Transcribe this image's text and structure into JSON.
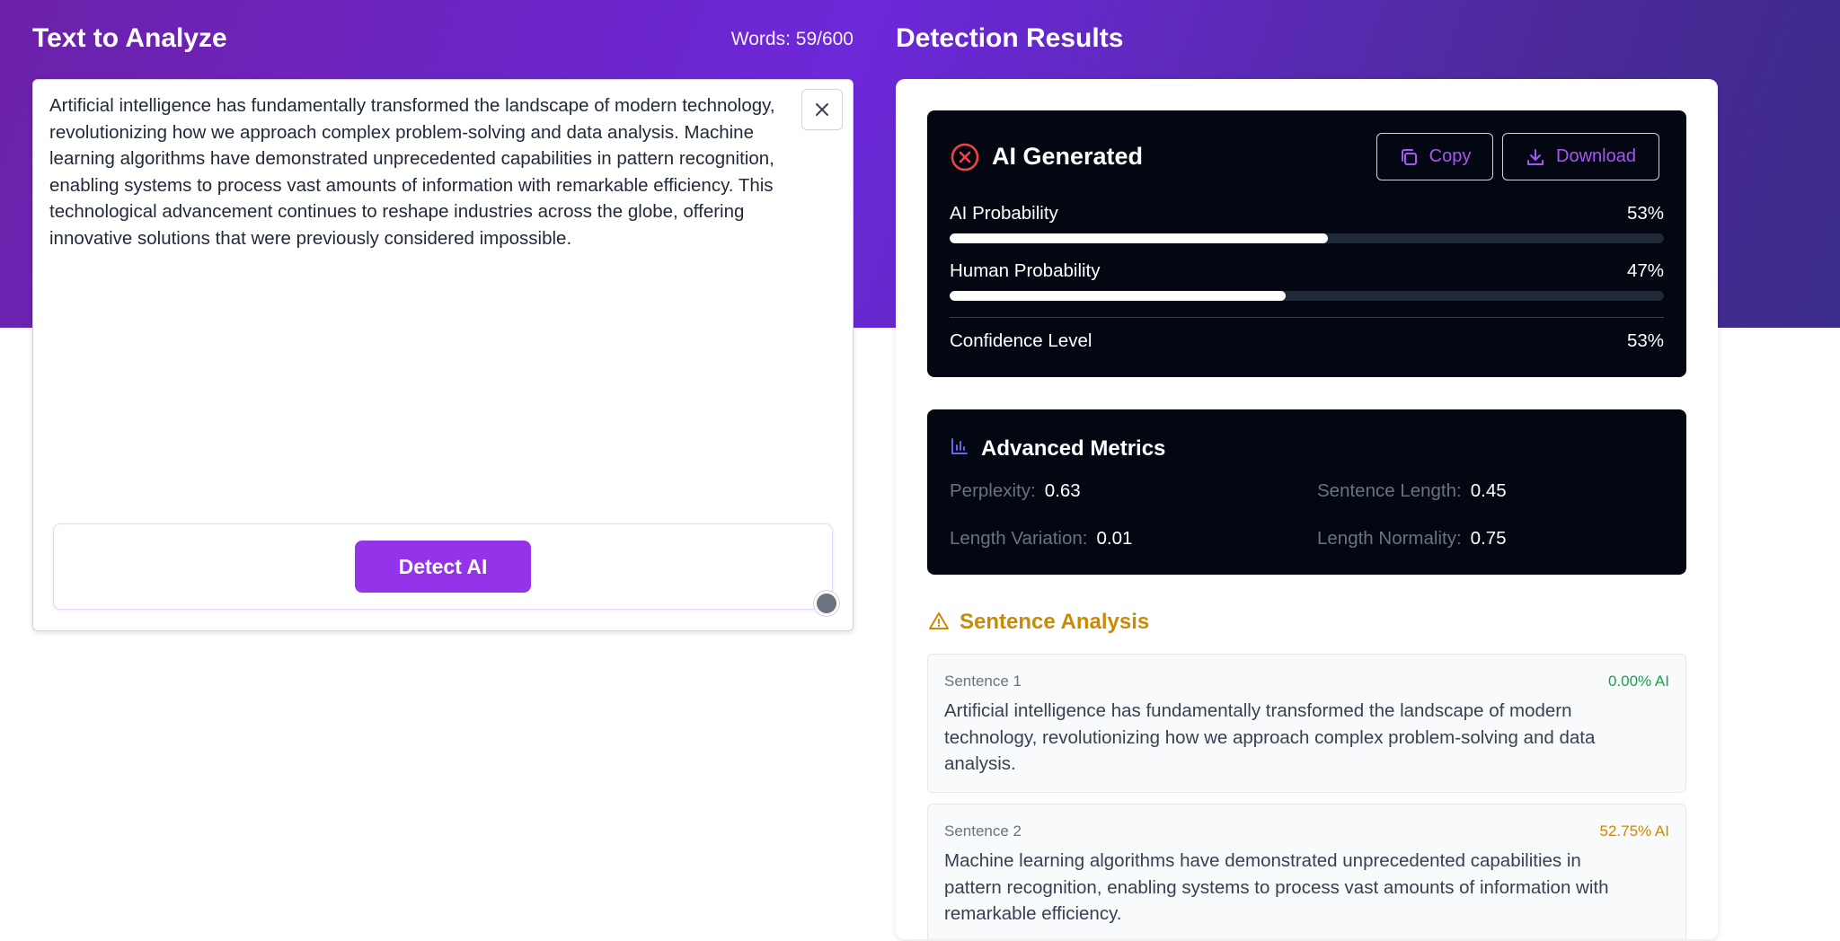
{
  "input_panel": {
    "title": "Text to Analyze",
    "word_count": "Words: 59/600",
    "text_lines": [
      "Artificial intelligence has fundamentally transformed the landscape of modern technology,",
      "revolutionizing how we approach complex problem-solving and data analysis. Machine",
      "learning algorithms have demonstrated unprecedented capabilities in pattern recognition,",
      "enabling systems to process vast amounts of information with remarkable efficiency. This",
      "technological advancement continues to reshape industries across the globe, offering",
      "innovative solutions that were previously considered impossible."
    ],
    "clear_icon": "close-icon",
    "detect_button": "Detect AI"
  },
  "results_panel": {
    "title": "Detection Results",
    "verdict": {
      "label": "AI Generated",
      "icon": "x-circle-icon",
      "icon_color": "#ef4444",
      "copy_label": "Copy",
      "download_label": "Download",
      "ai_probability_label": "AI Probability",
      "ai_probability_value": "53%",
      "ai_probability_fraction": 0.53,
      "human_probability_label": "Human Probability",
      "human_probability_value": "47%",
      "human_probability_fraction": 0.47,
      "confidence_label": "Confidence Level",
      "confidence_value": "53%"
    },
    "advanced": {
      "title": "Advanced Metrics",
      "icon": "bar-chart-icon",
      "perplexity_label": "Perplexity:",
      "perplexity_value": "0.63",
      "sentence_length_label": "Sentence Length:",
      "sentence_length_value": "0.45",
      "length_variation_label": "Length Variation:",
      "length_variation_value": "0.01",
      "length_normality_label": "Length Normality:",
      "length_normality_value": "0.75"
    },
    "sentence_analysis": {
      "title": "Sentence Analysis",
      "icon": "warning-triangle-icon",
      "sentences": [
        {
          "label": "Sentence 1",
          "pct": "0.00% AI",
          "pct_color": "#16a34a",
          "lines": [
            "Artificial intelligence has fundamentally transformed the landscape of modern",
            "technology, revolutionizing how we approach complex problem-solving and data",
            "analysis."
          ]
        },
        {
          "label": "Sentence 2",
          "pct": "52.75% AI",
          "pct_color": "#ca8a04",
          "lines": [
            "Machine learning algorithms have demonstrated unprecedented capabilities in",
            "pattern recognition, enabling systems to process vast amounts of information with",
            "remarkable efficiency."
          ]
        }
      ]
    }
  },
  "colors": {
    "accent": "#9333ea",
    "hero_start": "#6b21a8",
    "hero_end": "#3b2b8a",
    "dark_panel": "#030712"
  }
}
